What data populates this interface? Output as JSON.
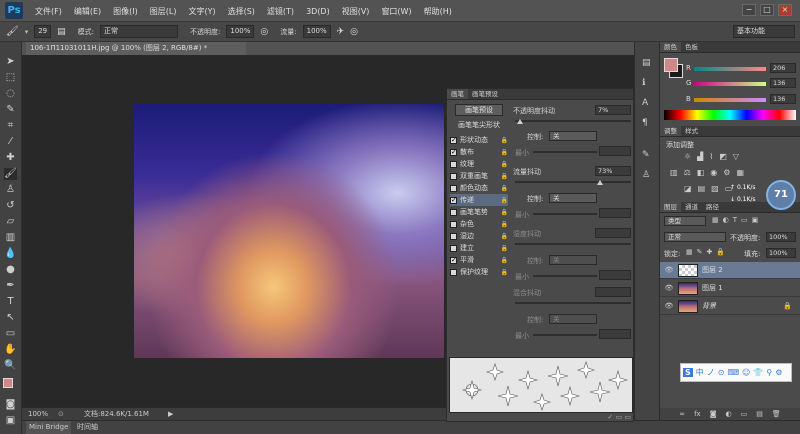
{
  "menubar": {
    "logo": "Ps",
    "items": [
      "文件(F)",
      "编辑(E)",
      "图像(I)",
      "图层(L)",
      "文字(Y)",
      "选择(S)",
      "滤镜(T)",
      "3D(D)",
      "视图(V)",
      "窗口(W)",
      "帮助(H)"
    ],
    "win_min": "−",
    "win_max": "□",
    "win_close": "×"
  },
  "options": {
    "brush_size": "29",
    "mode_label": "模式:",
    "mode_value": "正常",
    "opacity_label": "不透明度:",
    "opacity_value": "100%",
    "flow_label": "流量:",
    "flow_value": "100%",
    "workspace": "基本功能"
  },
  "document": {
    "tab_title": "106-1Π11031011H.jpg @ 100% (图层 2, RGB/8#) *",
    "zoom": "100%",
    "doc_info": "文档:824.6K/1.61M"
  },
  "bottom_tabs": [
    "Mini Bridge",
    "时间轴"
  ],
  "brush_panel": {
    "tabs": [
      "画笔",
      "画笔预设"
    ],
    "preset_button": "画笔预设",
    "tip_shape_label": "画笔笔尖形状",
    "items": [
      {
        "label": "形状动态",
        "checked": true
      },
      {
        "label": "散布",
        "checked": true
      },
      {
        "label": "纹理",
        "checked": false
      },
      {
        "label": "双重画笔",
        "checked": false
      },
      {
        "label": "颜色动态",
        "checked": false
      },
      {
        "label": "传递",
        "checked": true
      },
      {
        "label": "画笔笔势",
        "checked": false
      },
      {
        "label": "杂色",
        "checked": false
      },
      {
        "label": "湿边",
        "checked": false
      },
      {
        "label": "建立",
        "checked": false
      },
      {
        "label": "平滑",
        "checked": true
      },
      {
        "label": "保护纹理",
        "checked": false
      }
    ],
    "opacity_jitter_label": "不透明度抖动",
    "opacity_jitter_value": "7%",
    "control_label": "控制:",
    "control_value": "关",
    "min_label": "最小",
    "flow_jitter_label": "流量抖动",
    "flow_jitter_value": "73%",
    "control2_value": "关",
    "min2_label": "最小",
    "wetness_label": "湿度抖动",
    "control3_value": "关",
    "min3_label": "最小",
    "mix_label": "混合抖动",
    "control4_value": "关",
    "min4_label": "最小"
  },
  "color_panel": {
    "tabs": [
      "颜色",
      "色板"
    ],
    "r_label": "R",
    "r_value": "206",
    "g_label": "G",
    "g_value": "136",
    "b_label": "B",
    "b_value": "136",
    "swatch_color": "#ce8888"
  },
  "adjust_panel": {
    "tabs": [
      "调整",
      "样式"
    ],
    "title": "添加调整"
  },
  "gauge": {
    "value": "71",
    "up": "0.1K/s",
    "down": "0.1K/s"
  },
  "layers_panel": {
    "tabs": [
      "图层",
      "通道",
      "路径"
    ],
    "filter": "类型",
    "blend_mode": "正常",
    "opacity_label": "不透明度:",
    "opacity_value": "100%",
    "lock_label": "锁定:",
    "fill_label": "填充:",
    "fill_value": "100%",
    "layers": [
      {
        "name": "图层 2",
        "selected": true
      },
      {
        "name": "图层 1",
        "selected": false
      },
      {
        "name": "背景",
        "selected": false
      }
    ]
  },
  "ime": {
    "items": [
      "S",
      "中",
      "ノ",
      "⊙",
      "⌨",
      "☺",
      "👕",
      "⚲",
      "⚙"
    ]
  }
}
